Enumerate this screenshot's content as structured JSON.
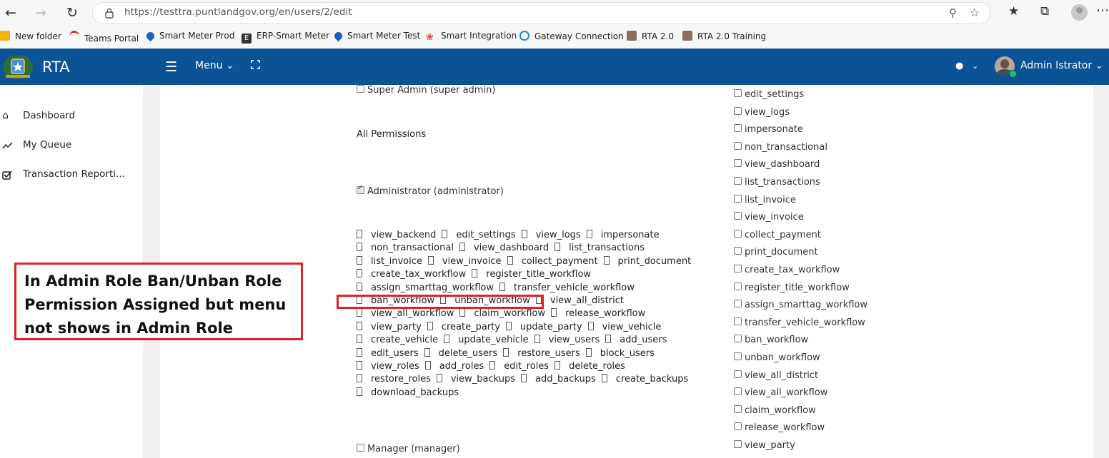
{
  "browser": {
    "url": "https://testtra.puntlandgov.org/en/users/2/edit"
  },
  "bookmarks": [
    {
      "label": "New folder",
      "icon": "folder-icon",
      "color": "#f4b400"
    },
    {
      "label": "Teams Portal",
      "icon": "teams-portal-icon",
      "color": "#d32f2f"
    },
    {
      "label": "Smart Meter Prod",
      "icon": "drop-icon",
      "color": "#1565c0"
    },
    {
      "label": "ERP-Smart Meter",
      "icon": "erp-icon",
      "color": "#333333"
    },
    {
      "label": "Smart Meter Test",
      "icon": "drop-icon",
      "color": "#1565c0"
    },
    {
      "label": "Smart Integration",
      "icon": "huawei-icon",
      "color": "#e53935"
    },
    {
      "label": "Gateway Connection",
      "icon": "gateway-icon",
      "color": "#1e88e5"
    },
    {
      "label": "RTA 2.0",
      "icon": "rta-emblem-icon",
      "color": "#6d4c41"
    },
    {
      "label": "RTA 2.0 Training",
      "icon": "rta-emblem-icon",
      "color": "#6d4c41"
    }
  ],
  "header": {
    "title": "RTA",
    "menu_label": "Menu ⌄",
    "user_name": "Admin Istrator ⌄",
    "bg_color": "#0b5394"
  },
  "sidebar": {
    "items": [
      {
        "label": "Dashboard",
        "icon": "home-icon"
      },
      {
        "label": "My Queue",
        "icon": "trend-icon"
      },
      {
        "label": "Transaction Reporti...",
        "icon": "check-square-icon"
      }
    ]
  },
  "roles": {
    "super_admin": {
      "label": "Super Admin (super admin)",
      "checked": false
    },
    "all_permissions_label": "All Permissions",
    "administrator": {
      "label": "Administrator (administrator)",
      "checked": true
    },
    "manager": {
      "label": "Manager (manager)",
      "checked": false
    }
  },
  "admin_permission_lines": [
    [
      "view_backend",
      "edit_settings",
      "view_logs",
      "impersonate"
    ],
    [
      "non_transactional",
      "view_dashboard",
      "list_transactions"
    ],
    [
      "list_invoice",
      "view_invoice",
      "collect_payment",
      "print_document"
    ],
    [
      "create_tax_workflow",
      "register_title_workflow"
    ],
    [
      "assign_smarttag_workflow",
      "transfer_vehicle_workflow"
    ],
    [
      "ban_workflow",
      "unban_workflow",
      "view_all_district"
    ],
    [
      "view_all_workflow",
      "claim_workflow",
      "release_workflow"
    ],
    [
      "view_party",
      "create_party",
      "update_party",
      "view_vehicle"
    ],
    [
      "create_vehicle",
      "update_vehicle",
      "view_users",
      "add_users"
    ],
    [
      "edit_users",
      "delete_users",
      "restore_users",
      "block_users"
    ],
    [
      "view_roles",
      "add_roles",
      "edit_roles",
      "delete_roles"
    ],
    [
      "restore_roles",
      "view_backups",
      "add_backups",
      "create_backups"
    ],
    [
      "download_backups"
    ]
  ],
  "right_permissions": [
    "edit_settings",
    "view_logs",
    "impersonate",
    "non_transactional",
    "view_dashboard",
    "list_transactions",
    "list_invoice",
    "view_invoice",
    "collect_payment",
    "print_document",
    "create_tax_workflow",
    "register_title_workflow",
    "assign_smarttag_workflow",
    "transfer_vehicle_workflow",
    "ban_workflow",
    "unban_workflow",
    "view_all_district",
    "view_all_workflow",
    "claim_workflow",
    "release_workflow",
    "view_party"
  ],
  "annotation": {
    "text": "In Admin Role Ban/Unban Role Permission Assigned but menu not shows in Admin Role",
    "color": "#e0202a"
  }
}
